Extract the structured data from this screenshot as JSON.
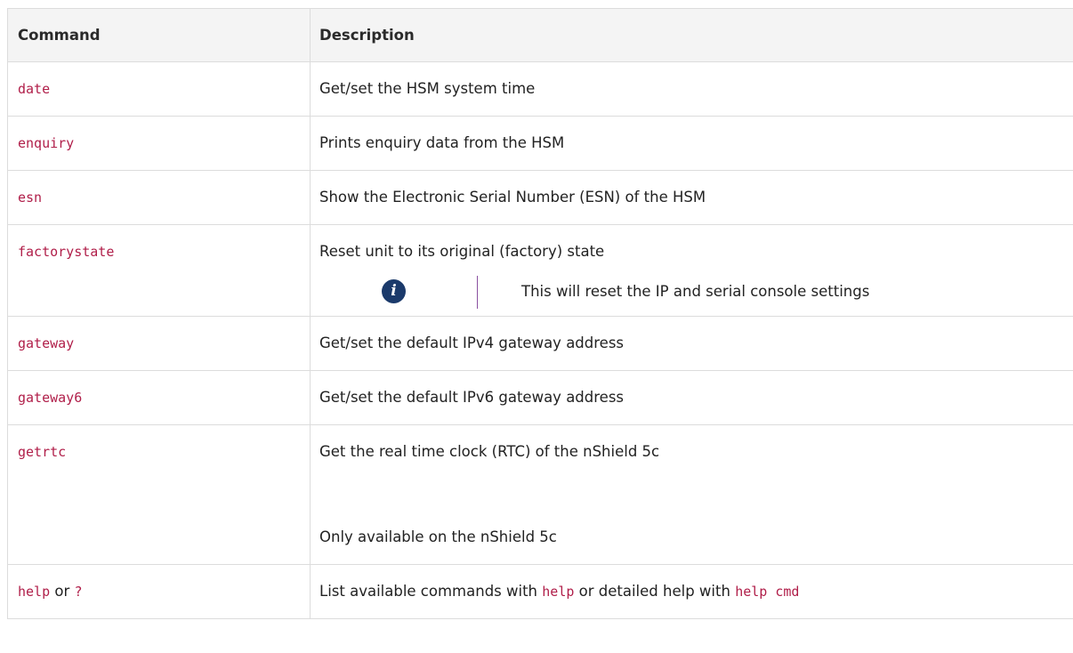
{
  "header": {
    "command": "Command",
    "description": "Description"
  },
  "rows": {
    "date": {
      "command": "date",
      "description": "Get/set the HSM system time"
    },
    "enquiry": {
      "command": "enquiry",
      "description": "Prints enquiry data from the HSM"
    },
    "esn": {
      "command": "esn",
      "description": "Show the Electronic Serial Number (ESN) of the HSM"
    },
    "factorystate": {
      "command": "factorystate",
      "description": "Reset unit to its original (factory) state",
      "note": {
        "icon": "info-icon",
        "text": "This will reset the IP and serial console settings"
      }
    },
    "gateway": {
      "command": "gateway",
      "description": "Get/set the default IPv4 gateway address"
    },
    "gateway6": {
      "command": "gateway6",
      "description": "Get/set the default IPv6 gateway address"
    },
    "getrtc": {
      "command": "getrtc",
      "description": "Get the real time clock (RTC) of the nShield 5c",
      "description_extra": "Only available on the nShield 5c"
    },
    "help": {
      "command": "help",
      "command_or": "or",
      "command_alt": "?",
      "description_prefix": "List available commands with",
      "description_code1": "help",
      "description_middle": "or detailed help with",
      "description_code2": "help cmd"
    }
  },
  "colors": {
    "code": "#b01e49",
    "info_icon_bg": "#1b3a6b",
    "note_rule": "#8a4fa0",
    "header_bg": "#f4f4f4",
    "border": "#dcdcdc"
  }
}
